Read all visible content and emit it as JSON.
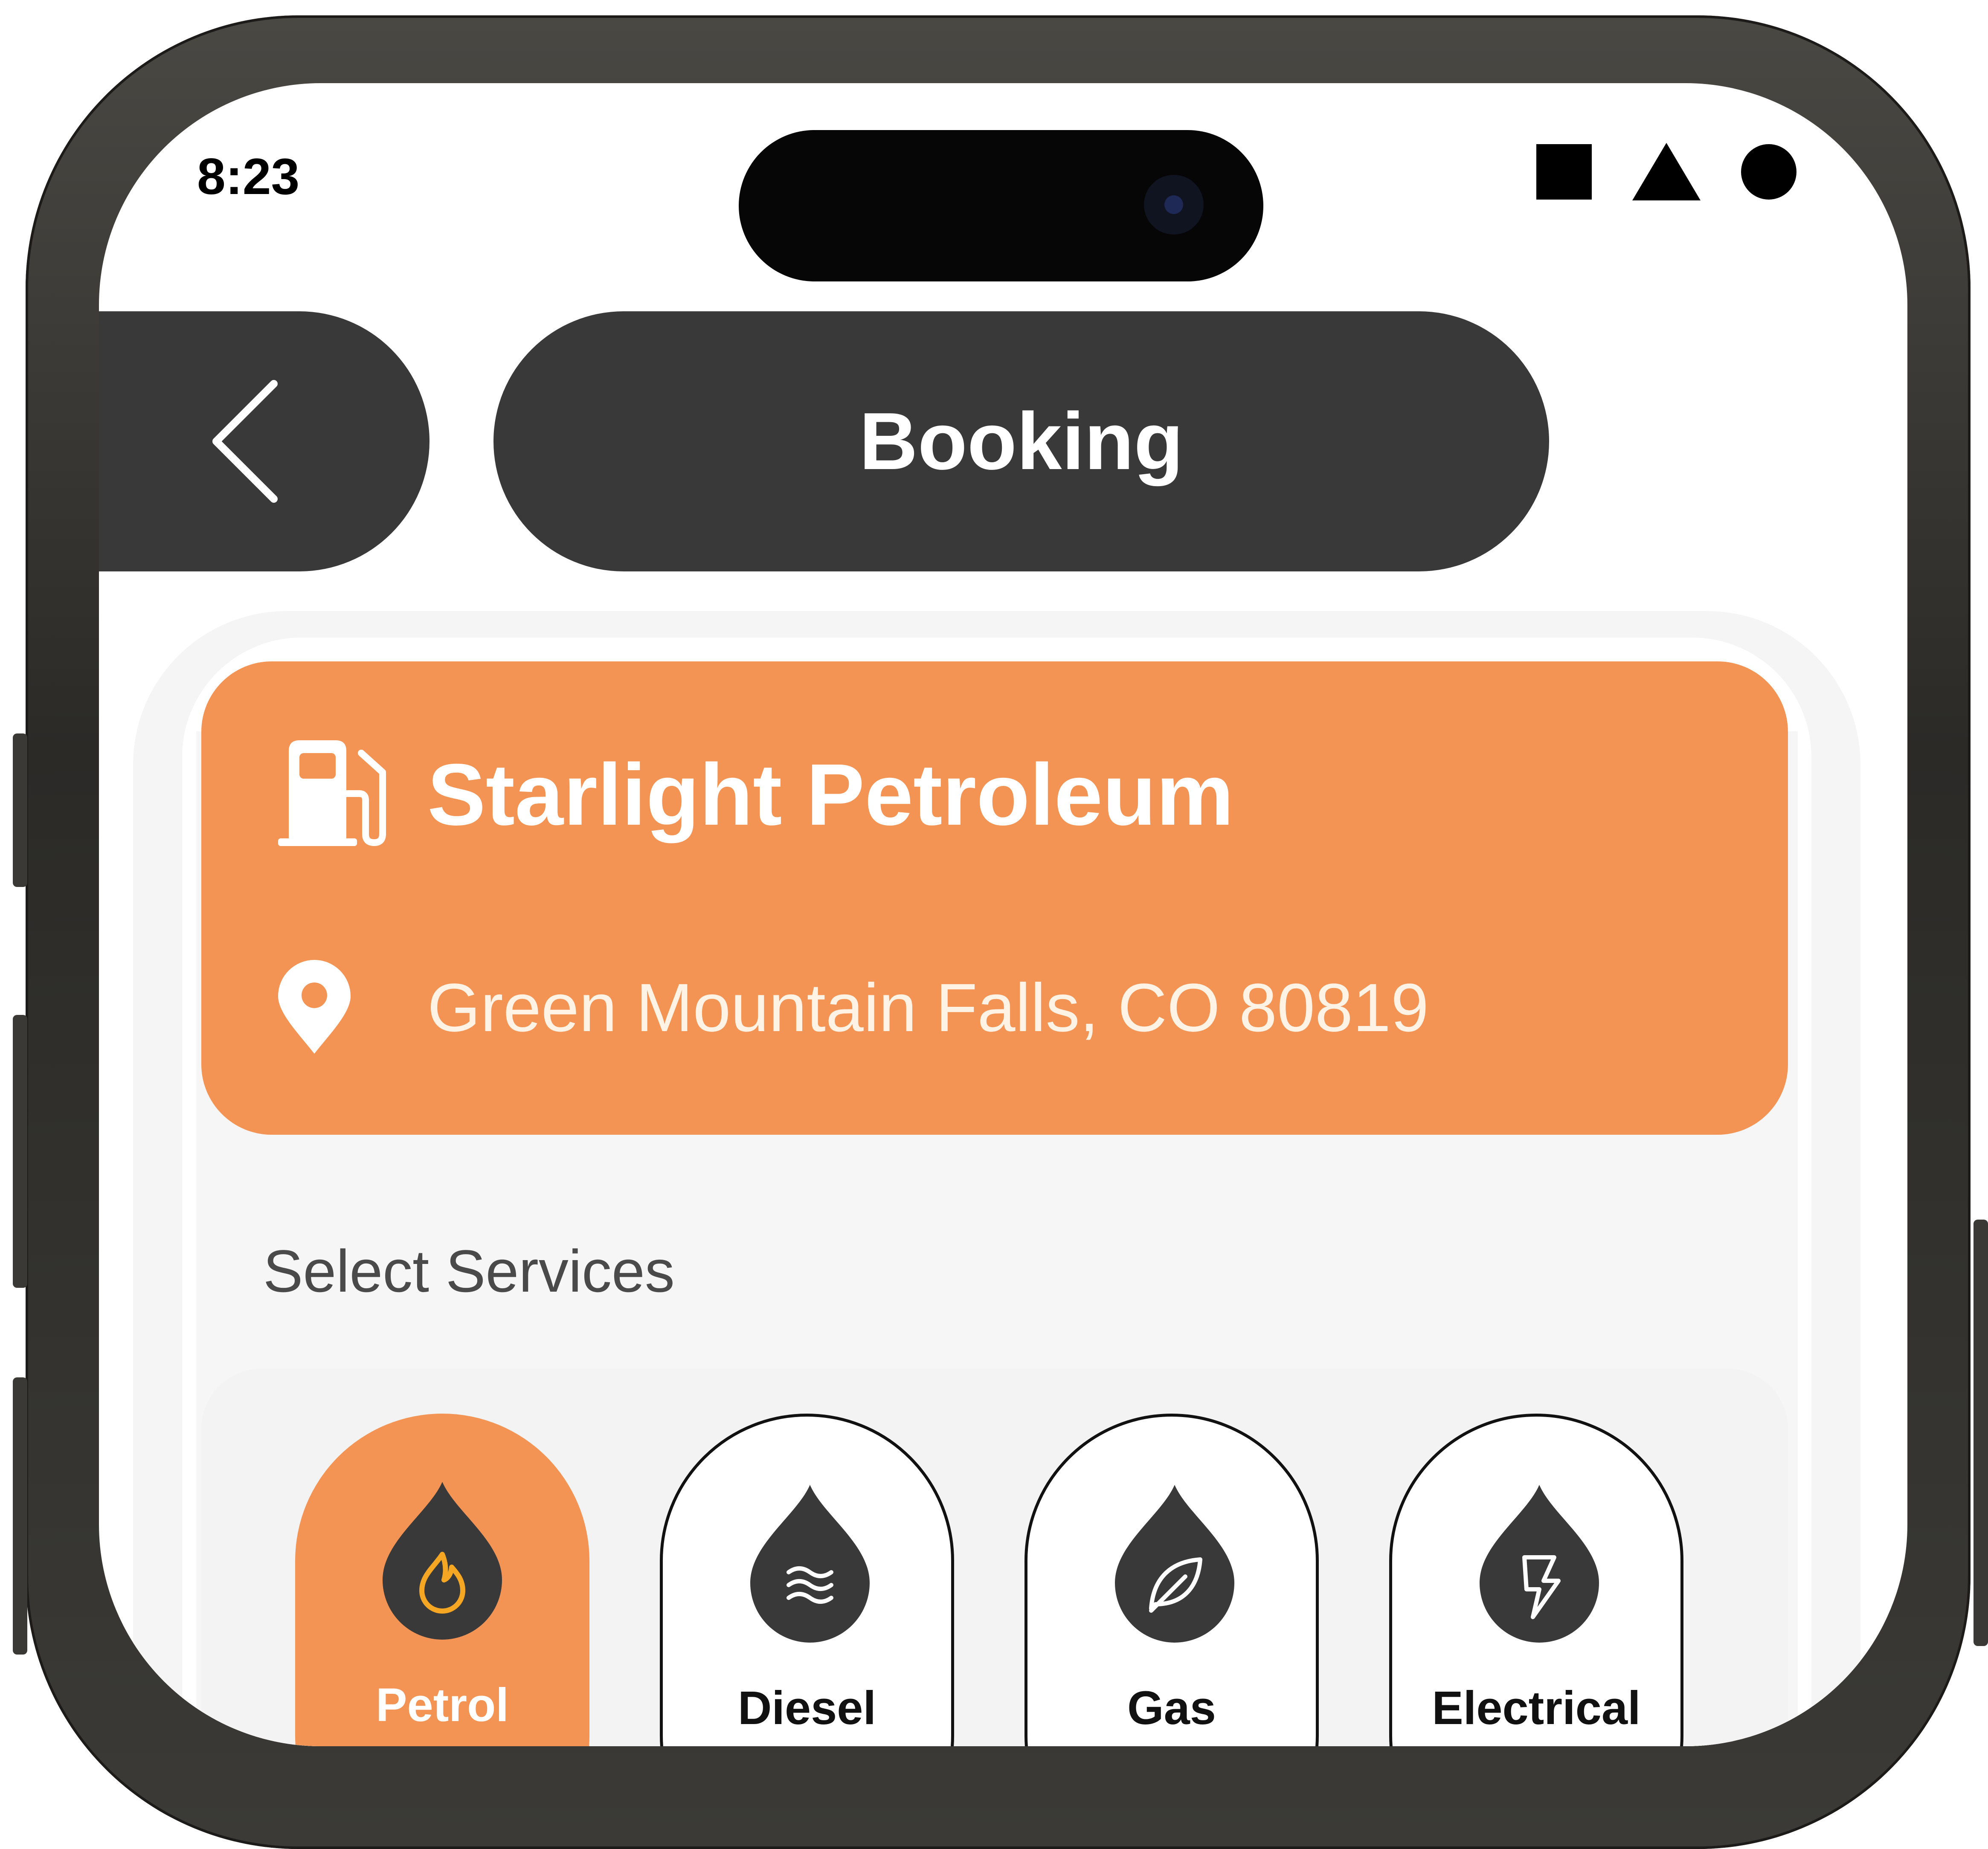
{
  "status_bar": {
    "time": "8:23",
    "icons": [
      "square-icon",
      "triangle-icon",
      "circle-icon"
    ]
  },
  "header": {
    "back_icon": "chevron-left-icon",
    "title": "Booking"
  },
  "station": {
    "name": "Starlight Petroleum",
    "address": "Green Mountain Falls, CO 80819",
    "name_icon": "fuel-pump-icon",
    "address_icon": "location-pin-icon",
    "color": "#f49454"
  },
  "services": {
    "label": "Select Services",
    "items": [
      {
        "label": "Petrol",
        "icon": "flame-drop-icon",
        "selected": true
      },
      {
        "label": "Diesel",
        "icon": "waves-drop-icon",
        "selected": false
      },
      {
        "label": "Gas",
        "icon": "leaf-drop-icon",
        "selected": false
      },
      {
        "label": "Electrical",
        "icon": "bolt-drop-icon",
        "selected": false
      }
    ]
  },
  "colors": {
    "accent": "#f49454",
    "dark": "#393939",
    "background": "#ffffff"
  }
}
